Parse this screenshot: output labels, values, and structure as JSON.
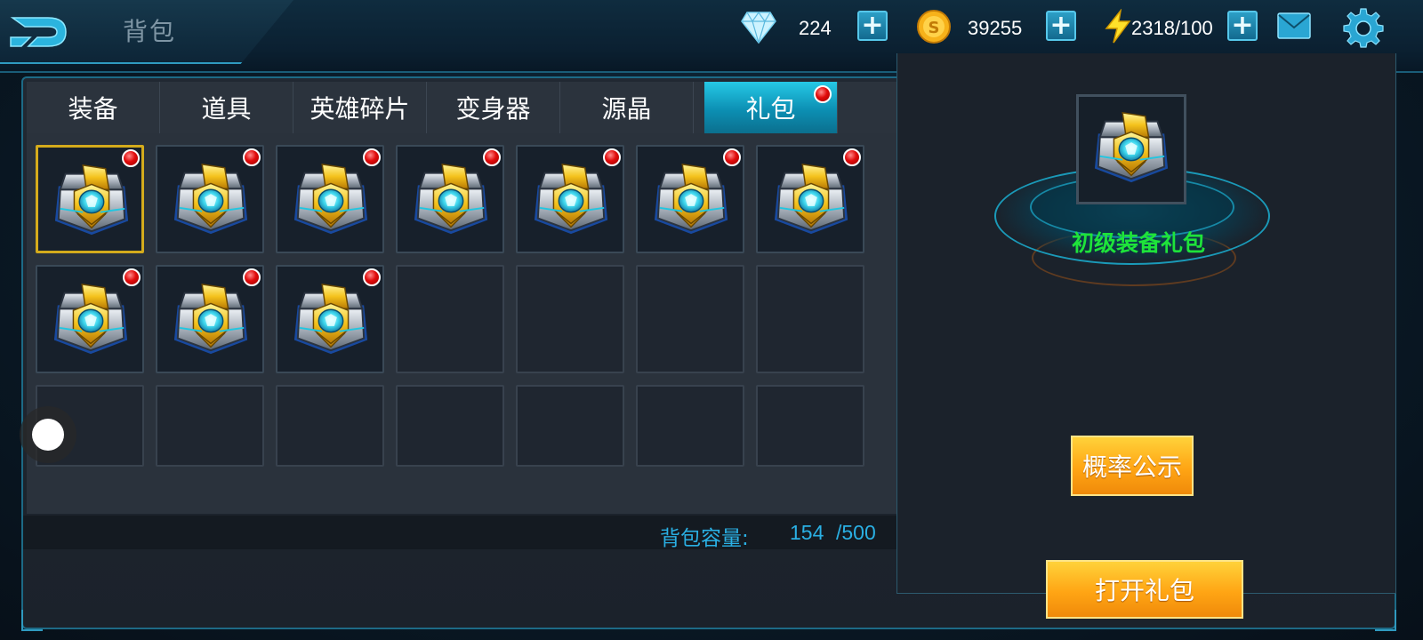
{
  "header": {
    "title": "背包",
    "resources": {
      "diamonds": "224",
      "coins": "39255",
      "energy": "2318/100"
    }
  },
  "tabs": [
    {
      "label": "装备",
      "active": false,
      "badge": false
    },
    {
      "label": "道具",
      "active": false,
      "badge": false
    },
    {
      "label": "英雄碎片",
      "active": false,
      "badge": false
    },
    {
      "label": "变身器",
      "active": false,
      "badge": false
    },
    {
      "label": "源晶",
      "active": false,
      "badge": false
    },
    {
      "label": "礼包",
      "active": true,
      "badge": true
    }
  ],
  "inventory": {
    "columns": 7,
    "rows": 3,
    "filled_count": 10,
    "item_icon": "gift-chest-icon",
    "selected_index": 0,
    "capacity_label": "背包容量:",
    "capacity_used": "154",
    "capacity_max": "/500"
  },
  "detail": {
    "item_name": "初级装备礼包",
    "item_name_color": "#1ee33a",
    "probability_button": "概率公示",
    "open_button": "打开礼包"
  },
  "colors": {
    "active_tab": "#0c8fb3",
    "accent_text": "#2ab0e4",
    "button_gold": "#ffa514",
    "selected_border": "#d4ab1c",
    "badge_red": "#e10b0b"
  }
}
